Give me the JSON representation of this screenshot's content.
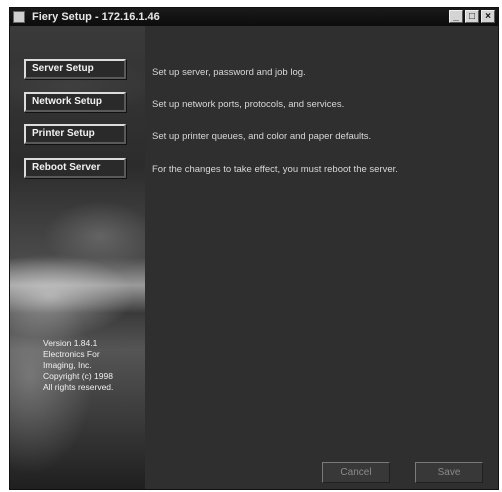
{
  "window": {
    "title": "Fiery Setup - 172.16.1.46",
    "controls": {
      "minimize": "_",
      "maximize": "□",
      "close": "×"
    }
  },
  "menu": [
    {
      "label": "Server Setup",
      "description": "Set up server, password and job log."
    },
    {
      "label": "Network Setup",
      "description": "Set up network ports, protocols, and services."
    },
    {
      "label": "Printer Setup",
      "description": "Set up printer queues, and color and paper defaults."
    },
    {
      "label": "Reboot Server",
      "description": "For the changes to take effect, you must reboot the server."
    }
  ],
  "version_info": {
    "version": "Version 1.84.1",
    "line1": "Electronics For",
    "line2": "Imaging, Inc.",
    "line3": "Copyright (c) 1998",
    "line4": "All rights reserved."
  },
  "footer": {
    "cancel_label": "Cancel",
    "save_label": "Save"
  },
  "colors": {
    "background": "#2f2f2f",
    "titlebar": "#0c0c0c",
    "button_face": "#2a2a2a",
    "disabled_text": "#8a8a8a"
  }
}
